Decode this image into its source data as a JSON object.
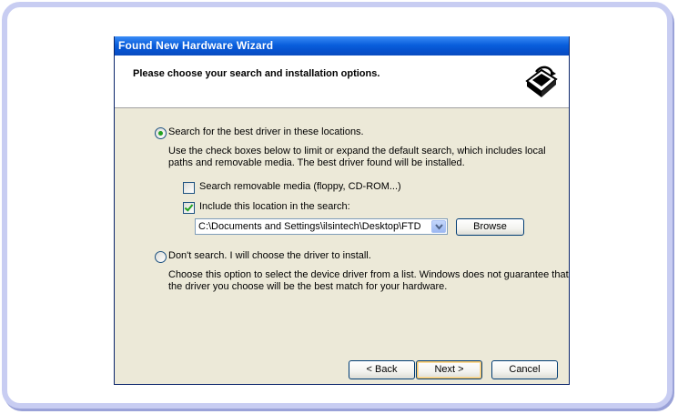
{
  "window": {
    "title": "Found New Hardware Wizard",
    "header_title": "Please choose your search and installation options."
  },
  "options": {
    "search": {
      "label": "Search for the best driver in these locations.",
      "selected": true,
      "description_line1": "Use the check boxes below to limit or expand the default search, which includes local",
      "description_line2": "paths and removable media. The best driver found will be installed.",
      "removable_media": {
        "label": "Search removable media (floppy, CD-ROM...)",
        "checked": false
      },
      "include_location": {
        "label": "Include this location in the search:",
        "checked": true
      },
      "location_value": "C:\\Documents and Settings\\ilsintech\\Desktop\\FTD",
      "browse_label": "Browse"
    },
    "dont_search": {
      "label": "Don't search. I will choose the driver to install.",
      "selected": false,
      "description_line1": "Choose this option to select the device driver from a list.  Windows does not guarantee that",
      "description_line2": "the driver you choose will be the best match for your hardware."
    }
  },
  "buttons": {
    "back": "< Back",
    "next": "Next >",
    "cancel": "Cancel"
  },
  "icons": {
    "header": "hardware-wizard-icon",
    "combo": "chevron-down-icon"
  }
}
